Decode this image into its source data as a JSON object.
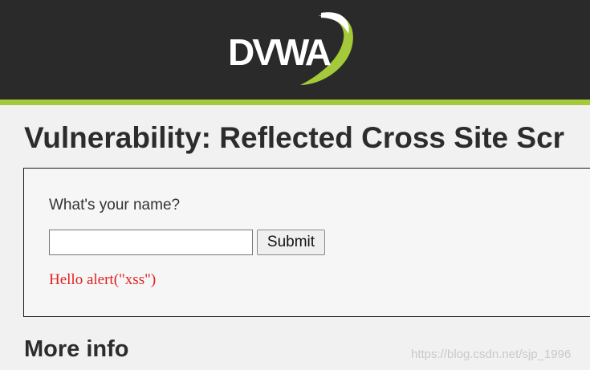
{
  "header": {
    "logo_text": "DVWA",
    "colors": {
      "background": "#2a2a2a",
      "accent": "#a4c939",
      "logo_text": "#ffffff",
      "swoosh": "#a4c939"
    }
  },
  "main": {
    "title": "Vulnerability: Reflected Cross Site Scr",
    "form": {
      "question": "What's your name?",
      "name_value": "",
      "submit_label": "Submit"
    },
    "result": "Hello alert(\"xss\")",
    "result_color": "#e02020",
    "more_info_heading": "More info"
  },
  "watermark": "https://blog.csdn.net/sjp_1996"
}
